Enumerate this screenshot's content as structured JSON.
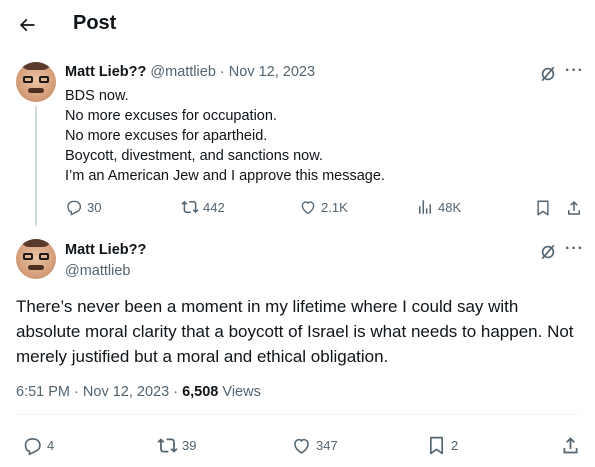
{
  "header": {
    "title": "Post"
  },
  "tweet1": {
    "author_name": "Matt Lieb??",
    "handle": "@mattlieb",
    "separator": "·",
    "date": "Nov 12, 2023",
    "lines": [
      "BDS now.",
      "No more excuses for occupation.",
      "No more excuses for apartheid.",
      "Boycott, divestment, and sanctions now.",
      "I’m an American Jew and I approve this message."
    ],
    "stats": {
      "replies": "30",
      "reposts": "442",
      "likes": "2.1K",
      "views": "48K"
    }
  },
  "tweet2": {
    "author_name": "Matt Lieb??",
    "handle": "@mattlieb",
    "text": "There’s never been a moment in my lifetime where I could say with absolute moral clarity that a boycott of Israel is what needs to happen. Not merely justified but a moral and ethical obligation.",
    "time": "6:51 PM",
    "date": "Nov 12, 2023",
    "separator": "·",
    "views_count": "6,508",
    "views_label": "Views",
    "stats": {
      "replies": "4",
      "reposts": "39",
      "likes": "347",
      "bookmarks": "2"
    }
  },
  "icons": [
    "back-arrow-icon",
    "grok-icon",
    "more-icon",
    "reply-icon",
    "repost-icon",
    "like-icon",
    "views-icon",
    "bookmark-icon",
    "share-icon"
  ],
  "colors": {
    "text": "#0f1419",
    "muted": "#536471",
    "divider": "#eff3f4"
  }
}
